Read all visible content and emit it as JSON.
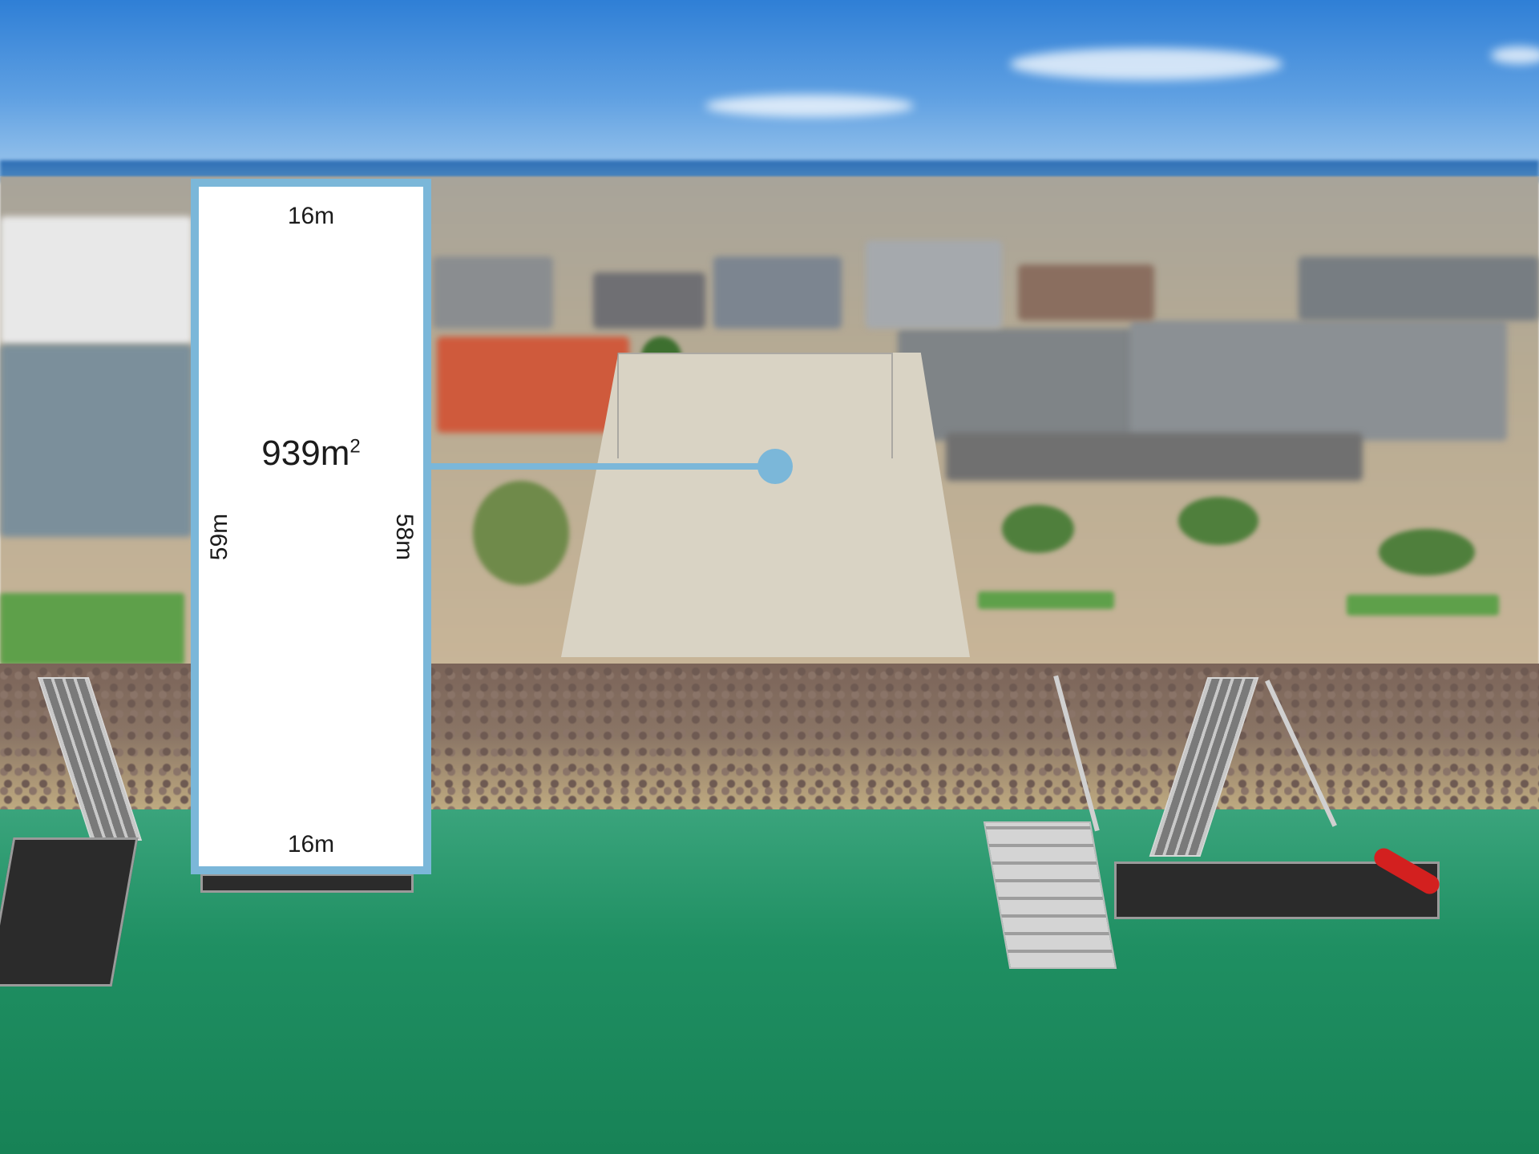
{
  "photo": {
    "description_icon": "aerial-photo",
    "colors": {
      "outline": "#7bb7d9",
      "panel": "#ffffff",
      "water": "#1f8f62",
      "sky": "#3f8ad9"
    }
  },
  "plan": {
    "top_width": "16m",
    "bottom_width": "16m",
    "left_length": "59m",
    "right_length": "58m",
    "area_value": "939m",
    "area_unit_sup": "2"
  }
}
